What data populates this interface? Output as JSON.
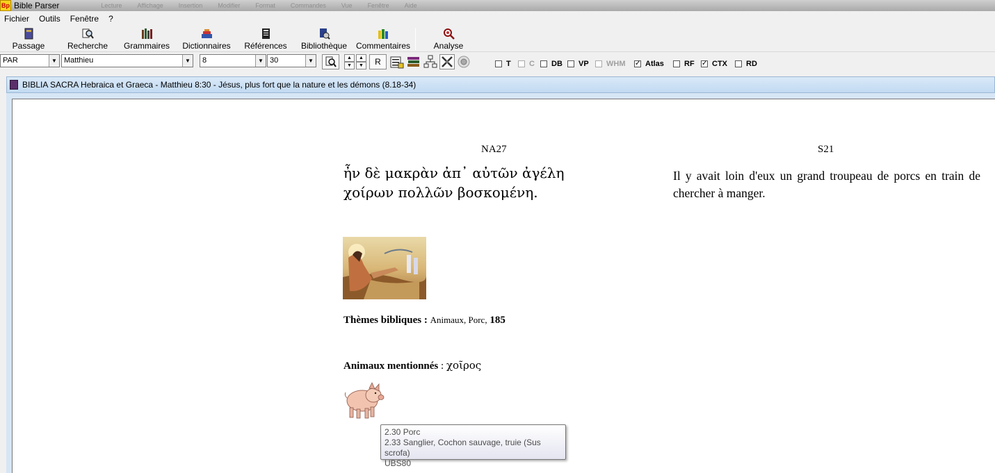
{
  "window": {
    "title": "Bible Parser",
    "app_icon": "Bp"
  },
  "ghost_menu": [
    "Lecture",
    "Affichage",
    "Insertion",
    "Modifier",
    "Format",
    "Commandes",
    "Vue",
    "Fenêtre",
    "Aide"
  ],
  "menu": [
    "Fichier",
    "Outils",
    "Fenêtre",
    "?"
  ],
  "toolbar": [
    {
      "label": "Passage",
      "icon": "book-icon"
    },
    {
      "label": "Recherche",
      "icon": "magnifier-icon"
    },
    {
      "label": "Grammaires",
      "icon": "books-icon"
    },
    {
      "label": "Dictionnaires",
      "icon": "dictionary-icon"
    },
    {
      "label": "Références",
      "icon": "scroll-icon"
    },
    {
      "label": "Bibliothèque",
      "icon": "library-icon"
    },
    {
      "label": "Commentaires",
      "icon": "commentary-icon"
    },
    {
      "label": "Analyse",
      "icon": "analysis-icon"
    }
  ],
  "selectors": {
    "version": "PAR",
    "book": "Matthieu",
    "chapter": "8",
    "verse": "30",
    "r_button": "R"
  },
  "checkboxes": [
    {
      "label": "T",
      "checked": false,
      "enabled": true
    },
    {
      "label": "C",
      "checked": false,
      "enabled": false
    },
    {
      "label": "DB",
      "checked": false,
      "enabled": true
    },
    {
      "label": "VP",
      "checked": false,
      "enabled": true
    },
    {
      "label": "WHM",
      "checked": false,
      "enabled": false
    },
    {
      "label": "Atlas",
      "checked": true,
      "enabled": true
    },
    {
      "label": "RF",
      "checked": false,
      "enabled": true
    },
    {
      "label": "CTX",
      "checked": true,
      "enabled": true
    },
    {
      "label": "RD",
      "checked": false,
      "enabled": true
    }
  ],
  "document": {
    "title": "BIBLIA SACRA Hebraica et Graeca - Matthieu 8:30 - Jésus, plus fort que la nature et les démons (8.18-34)",
    "col_left": "NA27",
    "col_right": "S21",
    "greek_text": "ἦν δὲ μακρὰν ἀπ᾽ αὐτῶν ἀγέλη χοίρων πολλῶν βοσκομένη.",
    "french_text": "Il y avait loin d'eux un grand troupeau de porcs en train de chercher à manger.",
    "themes_label": "Thèmes bibliques :",
    "themes_values": "Animaux, Porc,",
    "themes_number": "185",
    "animals_label": "Animaux mentionnés",
    "animals_sep": " : ",
    "animals_word": "χοῖρος"
  },
  "tooltip": {
    "line1": "2.30 Porc",
    "line2": "2.33 Sanglier, Cochon sauvage, truie (Sus scrofa)",
    "line3": "UBS80"
  }
}
